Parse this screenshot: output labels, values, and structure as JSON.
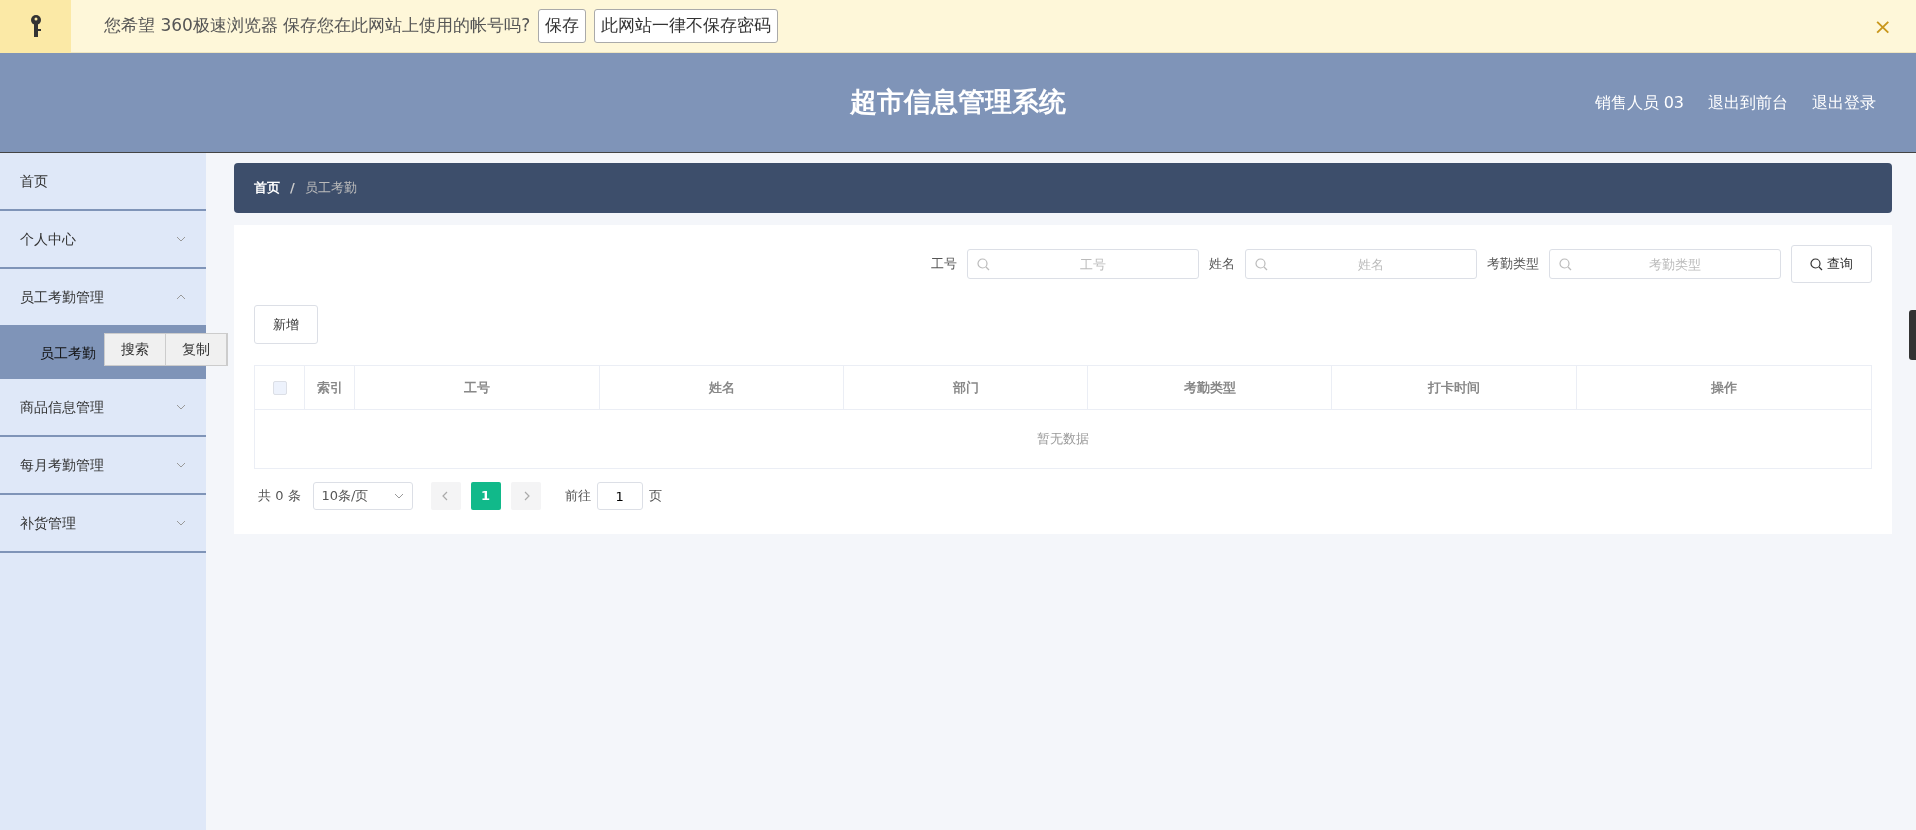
{
  "password_bar": {
    "message": "您希望 360极速浏览器 保存您在此网站上使用的帐号吗?",
    "buttons": [
      "保存",
      "此网站一律不保存密码"
    ],
    "close": "×"
  },
  "header": {
    "title": "超市信息管理系统",
    "links": [
      "销售人员 03",
      "退出到前台",
      "退出登录"
    ]
  },
  "sidebar": {
    "items": [
      {
        "label": "首页",
        "kind": "link"
      },
      {
        "label": "个人中心",
        "kind": "menu",
        "expanded": false
      },
      {
        "label": "员工考勤管理",
        "kind": "menu",
        "expanded": true,
        "children": [
          {
            "label": "员工考勤",
            "selected": true
          }
        ]
      },
      {
        "label": "商品信息管理",
        "kind": "menu",
        "expanded": false
      },
      {
        "label": "每月考勤管理",
        "kind": "menu",
        "expanded": false
      },
      {
        "label": "补货管理",
        "kind": "menu",
        "expanded": false
      }
    ]
  },
  "context_menu": [
    "搜索",
    "复制"
  ],
  "breadcrumb": [
    {
      "label": "首页"
    },
    {
      "label": "员工考勤"
    }
  ],
  "breadcrumb_separator": "/",
  "search": {
    "fields": [
      {
        "label": "工号",
        "placeholder": "工号"
      },
      {
        "label": "姓名",
        "placeholder": "姓名"
      },
      {
        "label": "考勤类型",
        "placeholder": "考勤类型"
      }
    ],
    "button": "查询"
  },
  "add_button": "新增",
  "table": {
    "checked": false,
    "columns": [
      "索引",
      "工号",
      "姓名",
      "部门",
      "考勤类型",
      "打卡时间",
      "操作"
    ],
    "empty_text": "暂无数据"
  },
  "pagination": {
    "total": "共 0 条",
    "page_size": "10条/页",
    "pages": [
      {
        "label": "1",
        "selected": true
      }
    ],
    "goto_label": "前往",
    "goto_value": "1",
    "goto_suffix": "页"
  }
}
